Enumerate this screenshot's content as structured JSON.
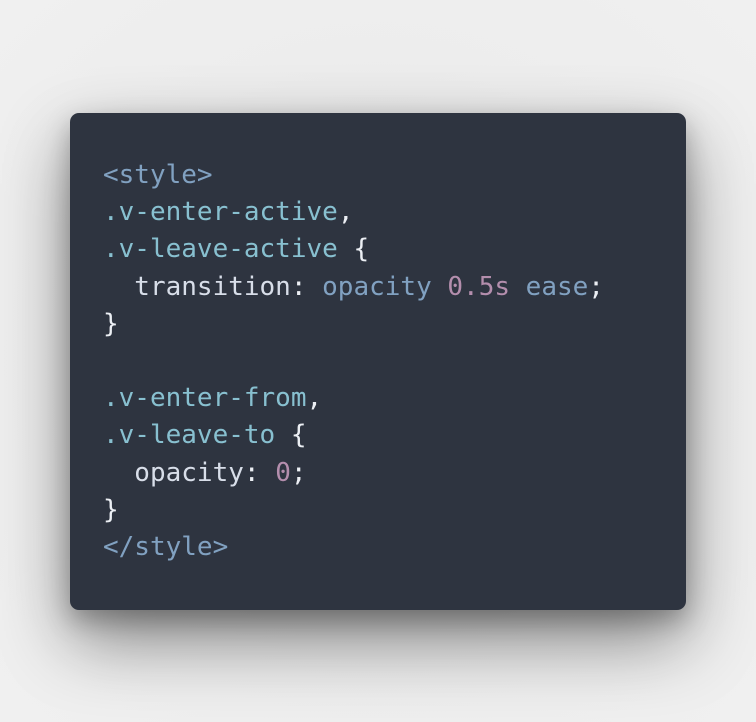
{
  "colors": {
    "background": "#ececec",
    "card": "#2e3440",
    "tag": "#81a1c1",
    "selector": "#88c0d0",
    "property": "#d8dee9",
    "punctuation": "#eceff4",
    "value": "#81a1c1",
    "number": "#b48ead"
  },
  "code": {
    "lines": [
      [
        {
          "t": "<style>",
          "c": "tag"
        }
      ],
      [
        {
          "t": ".v-enter-active",
          "c": "selector"
        },
        {
          "t": ",",
          "c": "punctuation"
        }
      ],
      [
        {
          "t": ".v-leave-active",
          "c": "selector"
        },
        {
          "t": " {",
          "c": "punctuation"
        }
      ],
      [
        {
          "t": "  transition",
          "c": "property"
        },
        {
          "t": ": ",
          "c": "punctuation"
        },
        {
          "t": "opacity",
          "c": "value"
        },
        {
          "t": " ",
          "c": "punctuation"
        },
        {
          "t": "0.5s",
          "c": "number"
        },
        {
          "t": " ",
          "c": "punctuation"
        },
        {
          "t": "ease",
          "c": "value"
        },
        {
          "t": ";",
          "c": "punctuation"
        }
      ],
      [
        {
          "t": "}",
          "c": "punctuation"
        }
      ],
      [],
      [
        {
          "t": ".v-enter-from",
          "c": "selector"
        },
        {
          "t": ",",
          "c": "punctuation"
        }
      ],
      [
        {
          "t": ".v-leave-to",
          "c": "selector"
        },
        {
          "t": " {",
          "c": "punctuation"
        }
      ],
      [
        {
          "t": "  opacity",
          "c": "property"
        },
        {
          "t": ": ",
          "c": "punctuation"
        },
        {
          "t": "0",
          "c": "number"
        },
        {
          "t": ";",
          "c": "punctuation"
        }
      ],
      [
        {
          "t": "}",
          "c": "punctuation"
        }
      ],
      [
        {
          "t": "</style>",
          "c": "tag"
        }
      ]
    ]
  }
}
